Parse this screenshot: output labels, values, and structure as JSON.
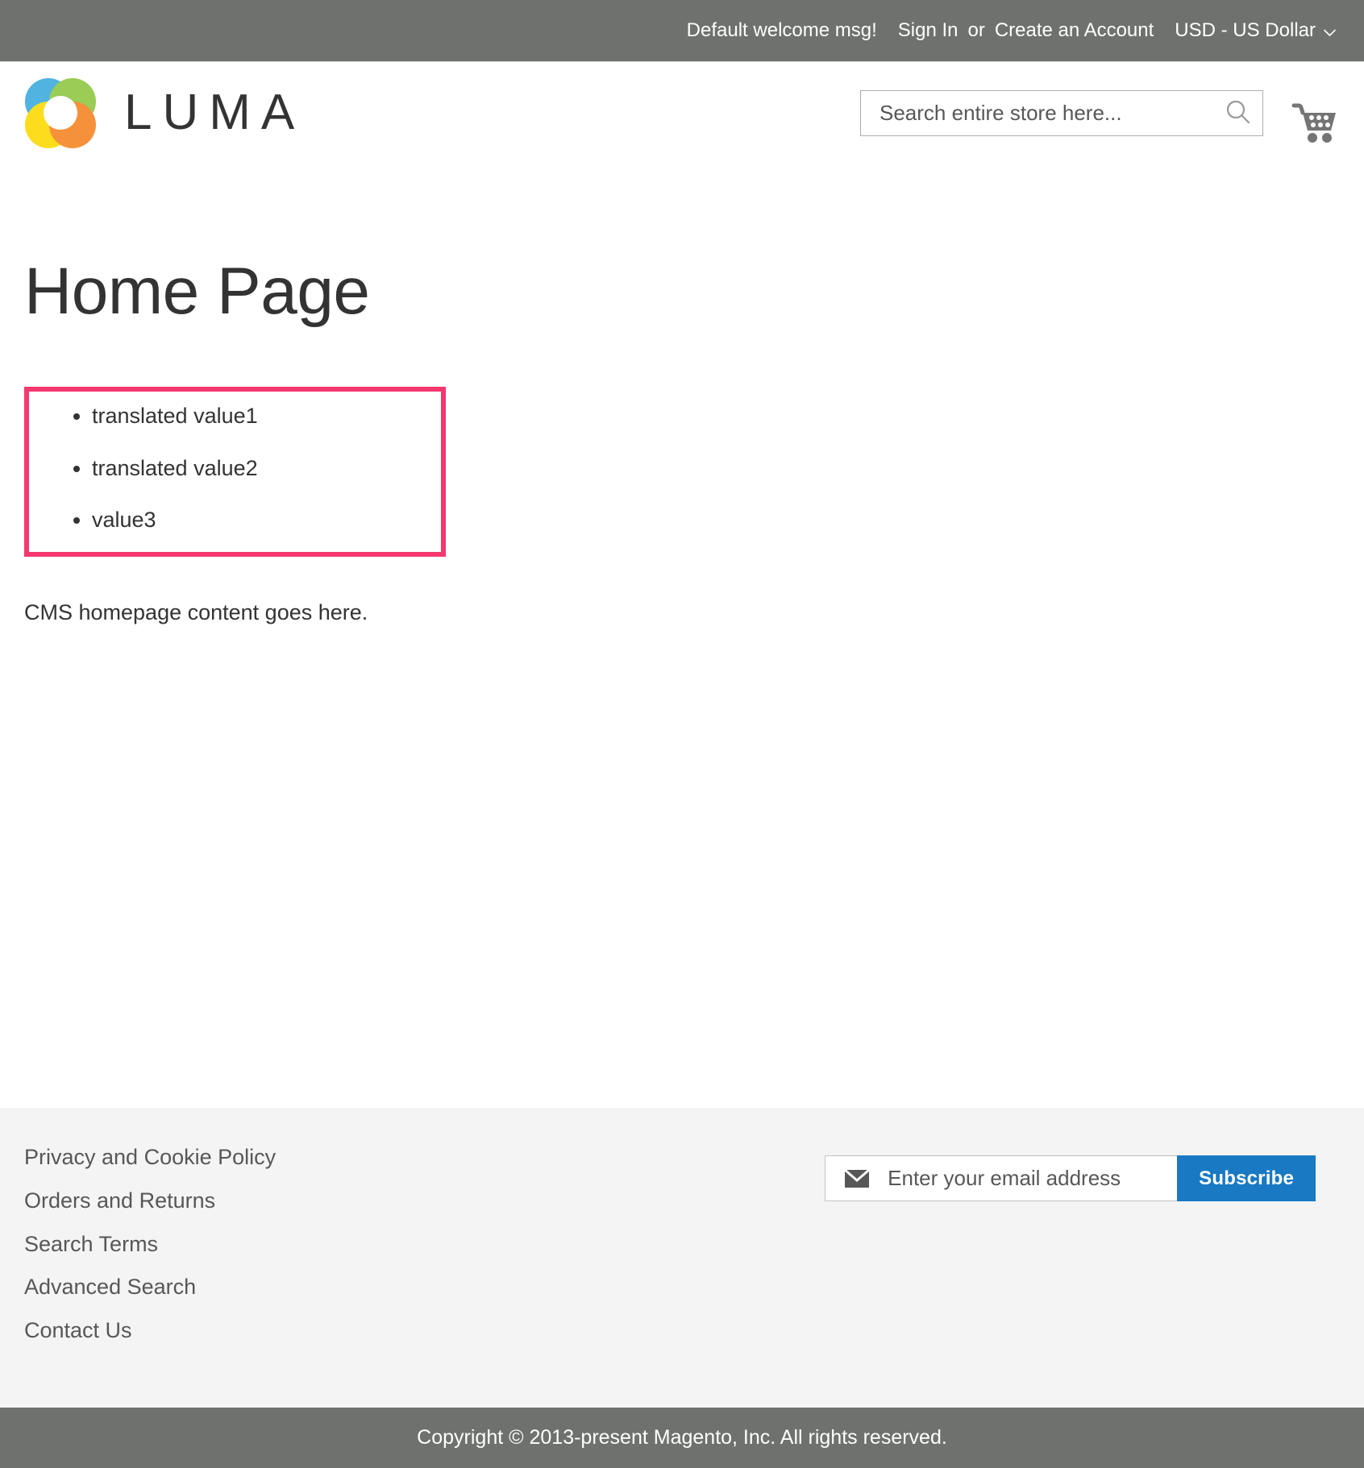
{
  "top_panel": {
    "welcome_message": "Default welcome msg!",
    "sign_in_label": "Sign In",
    "separator": "or",
    "create_account_label": "Create an Account",
    "currency_label": "USD - US Dollar",
    "background_color": "#6e716e"
  },
  "header": {
    "logo_text": "LUMA",
    "logo_colors": {
      "blue": "#39a9dc",
      "green": "#8dc63f",
      "yellow": "#fcd900",
      "orange": "#f58220"
    },
    "search": {
      "placeholder": "Search entire store here...",
      "value": ""
    },
    "cart_label": "My Cart"
  },
  "main": {
    "page_title": "Home Page",
    "highlight_border_color": "#f5376f",
    "list_items": [
      "translated value1",
      "translated value2",
      "value3"
    ],
    "paragraph": "CMS homepage content goes here."
  },
  "footer": {
    "background_color": "#f4f4f4",
    "links": [
      "Privacy and Cookie Policy",
      "Orders and Returns",
      "Search Terms",
      "Advanced Search",
      "Contact Us"
    ],
    "newsletter": {
      "placeholder": "Enter your email address",
      "value": "",
      "subscribe_label": "Subscribe",
      "button_color": "#1979c3"
    },
    "copyright": "Copyright © 2013-present Magento, Inc. All rights reserved."
  }
}
